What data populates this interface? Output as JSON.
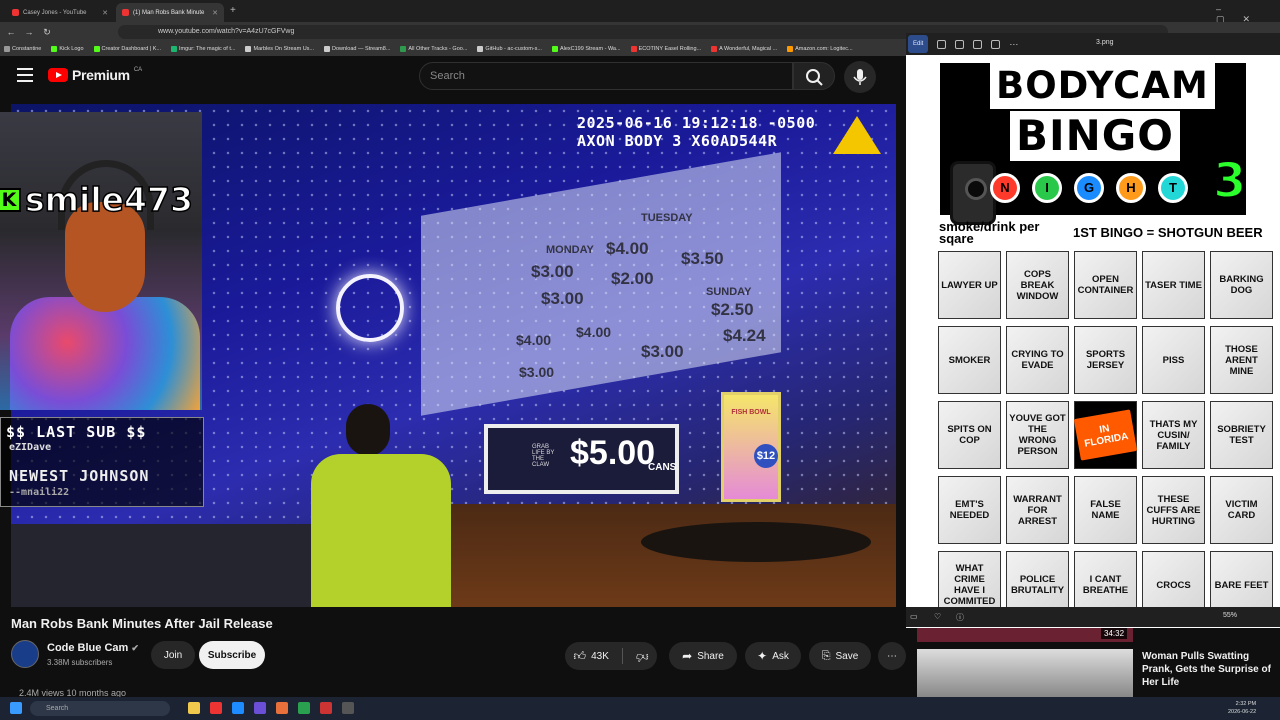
{
  "browser": {
    "tabs": [
      {
        "label": "Casey Jones - YouTube",
        "active": false
      },
      {
        "label": "(1) Man Robs Bank Minute",
        "active": true
      }
    ],
    "url": "www.youtube.com/watch?v=A4zU7cGFVwg",
    "bookmarks": [
      "Constantine",
      "Kick Logo",
      "Creator Dashboard | K...",
      "Imgur: The magic of t...",
      "Marbles On Stream Us...",
      "Download — Stream8...",
      "All Other Tracks - Goo...",
      "GitHub - ac-custom-s...",
      "AlexC199 Stream - Wa...",
      "ECOTINY Easel Rolling...",
      "A Wonderful, Magical ...",
      "Amazon.com: Logitec..."
    ]
  },
  "youtube": {
    "brand": "Premium",
    "region": "CA",
    "search_placeholder": "Search"
  },
  "video_overlay": {
    "timestamp": "2025-06-16 19:12:18 -0500",
    "device": "AXON BODY 3 X60AD544R",
    "menu_board": [
      "MONDAY",
      "TUESDAY",
      "$3.00",
      "$4.00",
      "$3.00",
      "$2.00",
      "$3.50",
      "SUNDAY",
      "$4.00",
      "$4.00",
      "$2.50",
      "$3.00",
      "$3.00",
      "$4.24"
    ],
    "cans_price": "$5.00",
    "cans_label": "CANS",
    "cans_side": "GRAB LIFE BY THE CLAW",
    "fishbowl": "FISH BOWL",
    "fishbowl_price": "$12"
  },
  "webcam": {
    "streamer": "smile473",
    "last_sub_title": "$$ LAST SUB $$",
    "last_sub_name": "eZIDave",
    "newest_title": "NEWEST JOHNSON",
    "newest_name": "--mnaili22"
  },
  "video_info": {
    "title": "Man Robs Bank Minutes After Jail Release",
    "channel": "Code Blue Cam",
    "subscribers": "3.38M subscribers",
    "join": "Join",
    "subscribe": "Subscribe",
    "likes": "43K",
    "share": "Share",
    "ask": "Ask",
    "save": "Save",
    "views": "2.4M views  10 months ago"
  },
  "viewer": {
    "edit": "Edit",
    "filename": "3.png",
    "zoom": "55%",
    "header_line1": "BODYCAM",
    "header_line2": "BINGO",
    "night_letters": [
      "N",
      "I",
      "G",
      "H",
      "T"
    ],
    "night_colors": [
      "#ff3a2a",
      "#2ac84a",
      "#1a8cff",
      "#ff9a1a",
      "#23d7d7"
    ],
    "edition": "3",
    "rule_left": "smoke/drink per sqare",
    "rule_right": "1ST BINGO = SHOTGUN BEER",
    "cells": [
      "LAWYER UP",
      "COPS BREAK WINDOW",
      "OPEN CONTAINER",
      "TASER TIME",
      "BARKING DOG",
      "SMOKER",
      "CRYING TO EVADE",
      "SPORTS JERSEY",
      "PISS",
      "THOSE ARENT MINE",
      "SPITS ON COP",
      "YOUVE GOT THE WRONG PERSON",
      "IN FLORIDA",
      "THATS MY CUSIN/ FAMILY",
      "SOBRIETY TEST",
      "EMT'S NEEDED",
      "WARRANT FOR ARREST",
      "FALSE NAME",
      "THESE CUFFS ARE HURTING",
      "VICTIM CARD",
      "WHAT CRIME HAVE I COMMITED",
      "POLICE BRUTALITY",
      "I CANT BREATHE",
      "CROCS",
      "BARE FEET"
    ]
  },
  "recommendations": [
    {
      "duration": "34:32"
    },
    {
      "title": "Woman Pulls Swatting Prank, Gets the Surprise of Her Life"
    }
  ],
  "taskbar": {
    "search": "Search",
    "time": "2:32 PM",
    "date": "2026-06-22"
  }
}
